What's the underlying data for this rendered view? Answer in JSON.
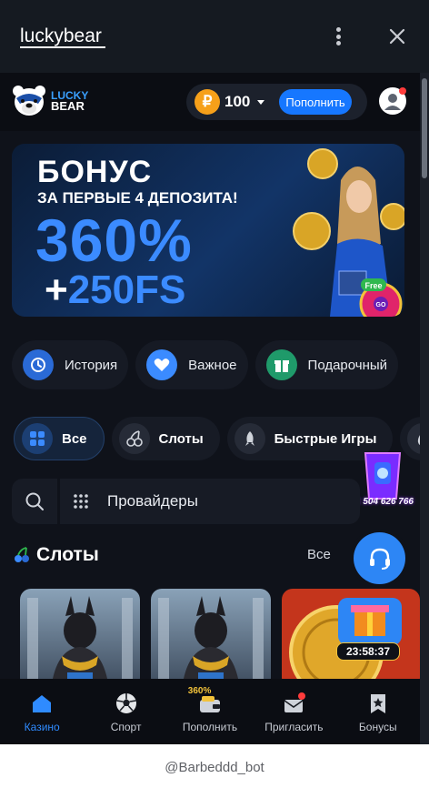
{
  "telegram": {
    "title": "luckybear",
    "menu_icon": "more-vertical-icon",
    "close_icon": "close-icon",
    "bot_name": "@Barbeddd_bot"
  },
  "header": {
    "logo_line1": "LUCKY",
    "logo_line2": "BEAR",
    "currency_symbol": "₽",
    "balance": "100",
    "deposit_label": "Пополнить"
  },
  "banner": {
    "line1": "БОНУС",
    "line2": "ЗА ПЕРВЫЕ 4 ДЕПОЗИТА!",
    "big": "360%",
    "fs_plus": "+",
    "fs": "250FS",
    "free_badge": "Free",
    "wheel_text": "GO"
  },
  "quick_links": [
    {
      "label": "История",
      "icon": "history-icon",
      "color": "#2a6ad6"
    },
    {
      "label": "Важное",
      "icon": "heart-icon",
      "color": "#3b8bff"
    },
    {
      "label": "Подарочный",
      "icon": "gift-icon",
      "color": "#1f9a6a"
    }
  ],
  "categories": [
    {
      "label": "Все",
      "icon": "grid-icon",
      "active": true
    },
    {
      "label": "Слоты",
      "icon": "cherries-icon",
      "active": false
    },
    {
      "label": "Быстрые Игры",
      "icon": "rocket-icon",
      "active": false
    }
  ],
  "search": {
    "providers_label": "Провайдеры"
  },
  "jackpot": {
    "value": "1 504 626 766"
  },
  "slots": {
    "title": "Слоты",
    "all_label": "Все",
    "timer": "23:58:37"
  },
  "bottom_nav": [
    {
      "label": "Казино",
      "icon": "home-icon",
      "active": true
    },
    {
      "label": "Спорт",
      "icon": "soccer-ball-icon",
      "active": false
    },
    {
      "label": "Пополнить",
      "icon": "wallet-icon",
      "active": false,
      "badge_text": "360%"
    },
    {
      "label": "Пригласить",
      "icon": "invite-icon",
      "active": false
    },
    {
      "label": "Бонусы",
      "icon": "bonus-icon",
      "active": false
    }
  ],
  "colors": {
    "accent": "#1677ff",
    "background": "#0f121a",
    "coin": "#f6a01a"
  }
}
